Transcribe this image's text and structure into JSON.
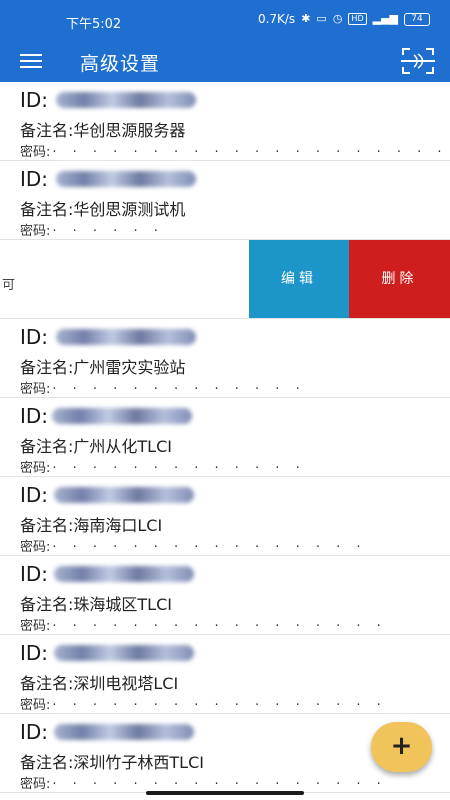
{
  "status_bar": {
    "time": "下午5:02",
    "net_speed": "0.7K/s",
    "battery": "74"
  },
  "app_bar": {
    "title": "高级设置",
    "menu_icon": "hamburger-menu-icon",
    "scan_icon": "scan-frame-icon"
  },
  "items": [
    {
      "id_label": "ID:",
      "remark": "备注名:华创思源服务器",
      "password_label": "密码:",
      "password_mask": "· · · · · · · · · · · · · · · · · · · ·"
    },
    {
      "id_label": "ID:",
      "remark": "备注名:华创思源测试机",
      "password_label": "密码:",
      "password_mask": "· · · · · ·"
    }
  ],
  "swiped_item": {
    "fragment": "可",
    "edit_label": "编辑",
    "delete_label": "删除"
  },
  "items2": [
    {
      "id_label": "ID:",
      "remark": "备注名:广州雷灾实验站",
      "password_label": "密码:",
      "password_mask": "· · · · · · · · · · · · ·"
    },
    {
      "id_label": "ID:",
      "remark": "备注名:广州从化TLCI",
      "password_label": "密码:",
      "password_mask": "· · · · · · · · · · · · ·"
    },
    {
      "id_label": "ID:",
      "remark": "备注名:海南海口LCI",
      "password_label": "密码:",
      "password_mask": "· · · · · · · · · · · · · · · ·"
    },
    {
      "id_label": "ID:",
      "remark": "备注名:珠海城区TLCI",
      "password_label": "密码:",
      "password_mask": "· · · · · · · · · · · · · · · · ·"
    },
    {
      "id_label": "ID:",
      "remark": "备注名:深圳电视塔LCI",
      "password_label": "密码:",
      "password_mask": "· · · · · · · · · · · · · · · · ·"
    },
    {
      "id_label": "ID:",
      "remark": "备注名:深圳竹子林西TLCI",
      "password_label": "密码:",
      "password_mask": "· · · · · · · · · · · · · · · · ·"
    }
  ],
  "fab": {
    "label": "+"
  },
  "colors": {
    "primary": "#1e6fcf",
    "edit": "#1c95c9",
    "delete": "#cf1e1e",
    "fab": "#f0c45a"
  }
}
